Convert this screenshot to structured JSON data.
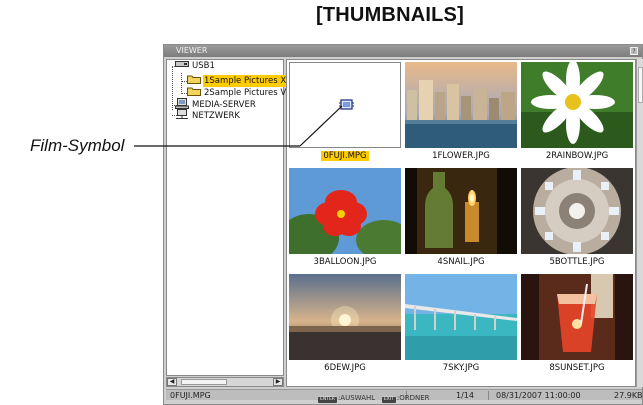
{
  "page": {
    "heading": "[THUMBNAILS]",
    "callout": "Film-Symbol"
  },
  "viewer": {
    "title": "VIEWER",
    "help": "?",
    "tree": [
      {
        "label": "USB1",
        "icon": "drive-icon"
      },
      {
        "label": "1Sample Pictures X",
        "icon": "folder-icon",
        "selected": true
      },
      {
        "label": "2Sample Pictures V",
        "icon": "folder-icon"
      },
      {
        "label": "MEDIA-SERVER",
        "icon": "server-icon"
      },
      {
        "label": "NETZWERK",
        "icon": "network-icon"
      }
    ],
    "thumbnails": [
      {
        "name": "0FUJI.MPG",
        "selected": true,
        "icon": "film-icon"
      },
      {
        "name": "1FLOWER.JPG",
        "icon": "city-photo"
      },
      {
        "name": "2RAINBOW.JPG",
        "icon": "flower-photo"
      },
      {
        "name": "3BALLOON.JPG",
        "icon": "hibiscus-photo"
      },
      {
        "name": "4SNAIL.JPG",
        "icon": "bottle-photo"
      },
      {
        "name": "5BOTTLE.JPG",
        "icon": "dome-photo"
      },
      {
        "name": "6DEW.JPG",
        "icon": "sunset-photo"
      },
      {
        "name": "7SKY.JPG",
        "icon": "bridge-photo"
      },
      {
        "name": "8SUNSET.JPG",
        "icon": "drink-photo"
      }
    ],
    "status": {
      "file": "0FUJI.MPG",
      "count": "1/14",
      "datetime": "08/31/2007 11:00:00",
      "size": "27.9KB"
    },
    "keyhints": {
      "enter_key": "ENTER",
      "enter_label": ":AUSWAHL",
      "exit_key": "EXIT",
      "exit_label": ":ORDNER"
    }
  },
  "colors": {
    "selection": "#ffcc00",
    "titlebar": "#8a8a8a",
    "frame": "#cfcfcf"
  }
}
